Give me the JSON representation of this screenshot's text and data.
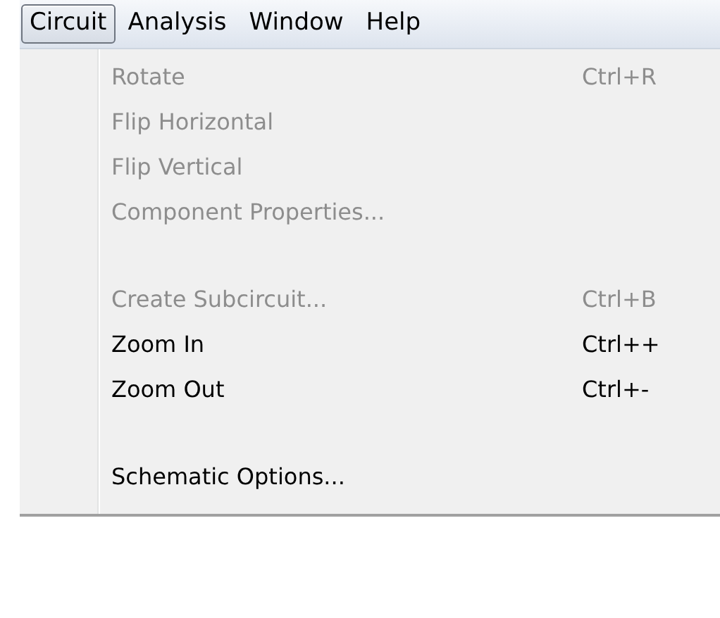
{
  "menu_bar": [
    {
      "label": "Circuit",
      "selected": true
    },
    {
      "label": "Analysis",
      "selected": false
    },
    {
      "label": "Window",
      "selected": false
    },
    {
      "label": "Help",
      "selected": false
    }
  ],
  "menu": {
    "items": [
      {
        "kind": "item",
        "label": "Rotate",
        "shortcut": "Ctrl+R",
        "disabled": true
      },
      {
        "kind": "item",
        "label": "Flip Horizontal",
        "disabled": true
      },
      {
        "kind": "item",
        "label": "Flip Vertical",
        "disabled": true
      },
      {
        "kind": "item",
        "label": "Component Properties...",
        "disabled": true
      },
      {
        "kind": "separator"
      },
      {
        "kind": "item",
        "label": "Create Subcircuit...",
        "shortcut": "Ctrl+B",
        "disabled": true
      },
      {
        "kind": "item",
        "label": "Zoom In",
        "shortcut": "Ctrl++",
        "disabled": false
      },
      {
        "kind": "item",
        "label": "Zoom Out",
        "shortcut": "Ctrl+-",
        "disabled": false
      },
      {
        "kind": "separator"
      },
      {
        "kind": "item",
        "label": "Schematic Options...",
        "disabled": false
      }
    ]
  }
}
